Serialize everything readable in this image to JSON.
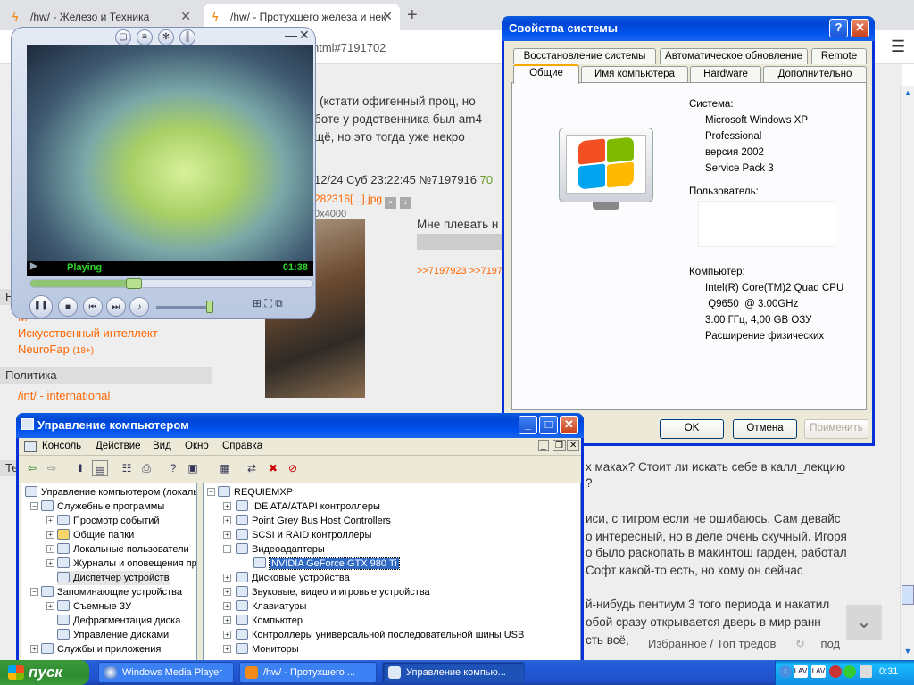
{
  "browser": {
    "tabs": [
      {
        "label": "/hw/ - Железо и Техника"
      },
      {
        "label": "/hw/ - Протухшего железа и нек"
      }
    ],
    "url_fragment": "html#7191702",
    "sidebar": {
      "header_partial": "Но",
      "links_top": [
        "М",
        "Искусственный интеллект",
        "NeuroFap"
      ],
      "neurofap_badge": "(18+)",
      "section_politics": "Политика",
      "link_international": "/int/ - international",
      "header_partial2": "Те"
    },
    "post1_lines": [
      "(кстати офигенный проц, но",
      "боте у родственника был am4",
      "щё, но это тогда уже некро"
    ],
    "post2": {
      "header": "12/24 Суб 23:22:45 №7197916",
      "number_suffix": "70",
      "file_name": "282316[...].jpg",
      "file_dims": "0x4000",
      "text": "Мне плевать н",
      "replies": ">>7197923 >>7197"
    },
    "post3_lines": [
      "х маках? Стоит ли искать себе в калл_лекцию",
      "?",
      "иси, с тигром если не ошибаюсь. Сам девайс",
      "о интересный, но в деле очень скучный. Игоря",
      "о было раскопать в макинтош гарден, работал",
      "Софт какой-то есть, но кому он сейчас",
      "й-нибудь пентиум 3 того периода и накатил",
      "обой сразу открывается дверь в мир ранн",
      "сть всё,"
    ],
    "bottom_bar": "Избранное / Топ тредов",
    "bottom_bar_tail": "под"
  },
  "sysprops": {
    "title": "Свойства системы",
    "tabs_row1": [
      "Восстановление системы",
      "Автоматическое обновление",
      "Remote"
    ],
    "tabs_row2": [
      "Общие",
      "Имя компьютера",
      "Hardware",
      "Дополнительно"
    ],
    "system_label": "Система:",
    "system_lines": [
      "Microsoft Windows XP",
      "Professional",
      "версия 2002",
      "Service Pack 3"
    ],
    "user_label": "Пользователь:",
    "computer_label": "Компьютер:",
    "computer_lines": [
      "Intel(R) Core(TM)2 Quad CPU",
      " Q9650  @ 3.00GHz",
      "3.00 ГГц, 4,00 GB ОЗУ",
      "Расширение физических"
    ],
    "buttons": {
      "ok": "OK",
      "cancel": "Отмена",
      "apply": "Применить"
    }
  },
  "wmp": {
    "status": "Playing",
    "time": "01:38"
  },
  "compmgmt": {
    "title": "Управление компьютером",
    "menu": [
      "Консоль",
      "Действие",
      "Вид",
      "Окно",
      "Справка"
    ],
    "left_tree": [
      "Управление компьютером (локальн",
      "Служебные программы",
      "Просмотр событий",
      "Общие папки",
      "Локальные пользователи",
      "Журналы и оповещения пр",
      "Диспетчер устройств",
      "Запоминающие устройства",
      "Съемные ЗУ",
      "Дефрагментация диска",
      "Управление дисками",
      "Службы и приложения"
    ],
    "right_tree": [
      "REQUIEMXP",
      "IDE ATA/ATAPI контроллеры",
      "Point Grey Bus Host Controllers",
      "SCSI и RAID контроллеры",
      "Видеоадаптеры",
      "NVIDIA GeForce GTX 980 Ti",
      "Дисковые устройства",
      "Звуковые, видео и игровые устройства",
      "Клавиатуры",
      "Компьютер",
      "Контроллеры универсальной последовательной шины USB",
      "Мониторы"
    ]
  },
  "taskbar": {
    "start": "пуск",
    "tasks": [
      "Windows Media Player",
      "/hw/ - Протухшего ...",
      "Управление компью..."
    ],
    "clock": "0:31",
    "tray_lang": "LAV"
  }
}
